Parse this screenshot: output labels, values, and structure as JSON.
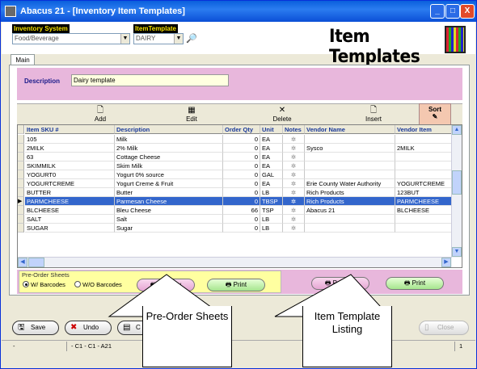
{
  "window": {
    "title": "Abacus 21 - [Inventory Item Templates]",
    "buttons": [
      "_",
      "□",
      "X"
    ]
  },
  "header": {
    "inventory_system_label": "Inventory System",
    "inventory_system_value": "Food/Beverage",
    "item_template_label": "ItemTemplate",
    "item_template_value": "DAIRY",
    "page_title": "Item Templates"
  },
  "tabs": [
    "Main"
  ],
  "description": {
    "label": "Description",
    "value": "Dairy template"
  },
  "toolbar": {
    "add": "Add",
    "edit": "Edit",
    "delete": "Delete",
    "insert": "Insert",
    "sort": "Sort"
  },
  "grid": {
    "columns": [
      "Item SKU #",
      "Description",
      "Order Qty",
      "Unit",
      "Notes",
      "Vendor Name",
      "Vendor Item"
    ],
    "rows": [
      {
        "sku": "105",
        "desc": "Milk",
        "qty": "0",
        "unit": "EA",
        "vendor": "",
        "vitem": ""
      },
      {
        "sku": "2MILK",
        "desc": "2% Milk",
        "qty": "0",
        "unit": "EA",
        "vendor": "Sysco",
        "vitem": "2MILK"
      },
      {
        "sku": "63",
        "desc": "Cottage Cheese",
        "qty": "0",
        "unit": "EA",
        "vendor": "",
        "vitem": ""
      },
      {
        "sku": "SKIMMILK",
        "desc": "Skim Milk",
        "qty": "0",
        "unit": "EA",
        "vendor": "",
        "vitem": ""
      },
      {
        "sku": "YOGURT0",
        "desc": "Yogurt 0% source",
        "qty": "0",
        "unit": "GAL",
        "vendor": "",
        "vitem": ""
      },
      {
        "sku": "YOGURTCREME",
        "desc": "Yogurt Creme & Fruit",
        "qty": "0",
        "unit": "EA",
        "vendor": "Erie County Water Authority",
        "vitem": "YOGURTCREME"
      },
      {
        "sku": "BUTTER",
        "desc": "Butter",
        "qty": "0",
        "unit": "LB",
        "vendor": "Rich Products",
        "vitem": "123BUT"
      },
      {
        "sku": "PARMCHEESE",
        "desc": "Parmesan Cheese",
        "qty": "0",
        "unit": "TBSP",
        "vendor": "Rich Products",
        "vitem": "PARMCHEESE"
      },
      {
        "sku": "BLCHEESE",
        "desc": "Bleu Cheese",
        "qty": "66",
        "unit": "TSP",
        "vendor": "Abacus 21",
        "vitem": "BLCHEESE"
      },
      {
        "sku": "SALT",
        "desc": "Salt",
        "qty": "0",
        "unit": "LB",
        "vendor": "",
        "vitem": ""
      },
      {
        "sku": "SUGAR",
        "desc": "Sugar",
        "qty": "0",
        "unit": "LB",
        "vendor": "",
        "vitem": ""
      }
    ],
    "selected_index": 7
  },
  "preorder": {
    "legend": "Pre-Order Sheets",
    "radio_with": "W/ Barcodes",
    "radio_without": "W/O Barcodes",
    "preview": "Preview",
    "print": "Print"
  },
  "template_listing": {
    "preview": "Preview",
    "print": "Print"
  },
  "bottom_buttons": {
    "save": "Save",
    "undo": "Undo",
    "third_visible": "C",
    "close": "Close"
  },
  "status": {
    "left": "-",
    "middle": "- C1 - C1 - A21",
    "right": "1"
  },
  "callouts": {
    "left": "Pre-Order Sheets",
    "right": "Item Template Listing"
  },
  "colors": {
    "titlebar": "#0a5fdc",
    "pink_band": "#e8b7dc",
    "selection": "#3366cc",
    "yellow_box": "#ffffa0"
  }
}
